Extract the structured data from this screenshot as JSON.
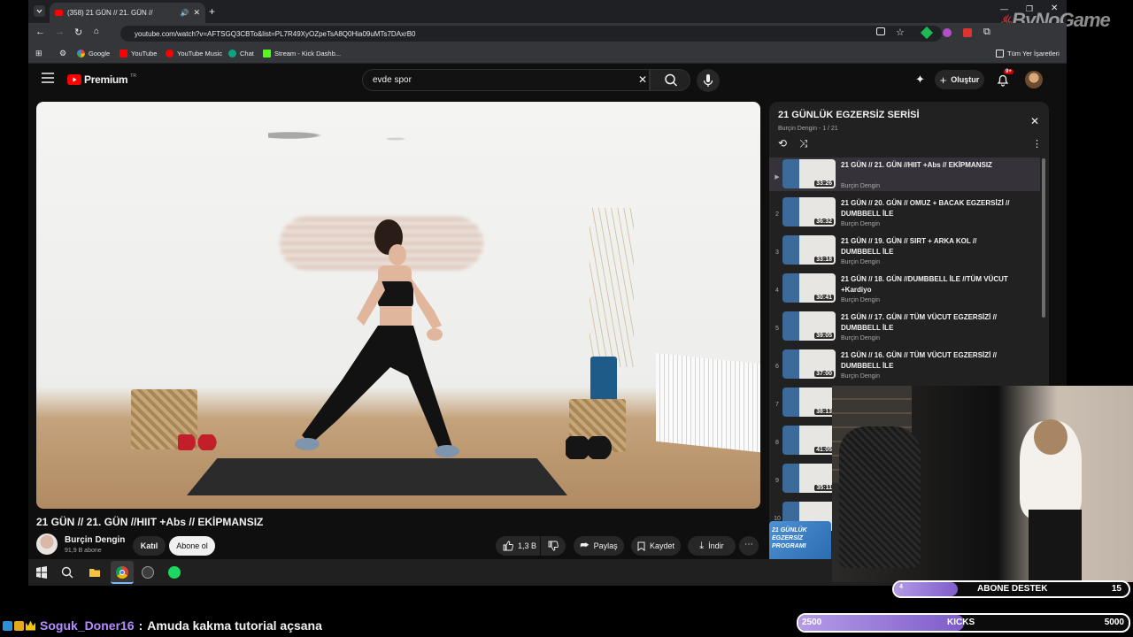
{
  "browser": {
    "tab_title": "(358) 21 GÜN // 21. GÜN //",
    "url": "youtube.com/watch?v=AFTSGQ3CBTo&list=PL7R49XyOZpeTsA8Q0Hia09uMTs7DAxrB0",
    "bookmarks": [
      "Google",
      "YouTube",
      "YouTube Music",
      "Chat",
      "Stream - Kick Dashb..."
    ],
    "all_bookmarks": "Tüm Yer İşaretleri"
  },
  "watermark": "ByNoGame",
  "youtube": {
    "logo_text": "Premium",
    "logo_sup": "TR",
    "search_value": "evde spor",
    "create_label": "Oluştur",
    "notification_badge": "9+",
    "video": {
      "title": "21 GÜN // 21. GÜN //HIIT +Abs // EKİPMANSIZ",
      "channel": "Burçin Dengin",
      "subscribers": "91,9 B abone",
      "join_label": "Katıl",
      "subscribe_label": "Abone ol",
      "likes": "1,3 B",
      "share_label": "Paylaş",
      "save_label": "Kaydet",
      "download_label": "İndir"
    },
    "playlist": {
      "title": "21 GÜNLÜK EGZERSİZ SERİSİ",
      "subtitle": "Burçin Dengin - 1 / 21",
      "items": [
        {
          "index": "▶",
          "title": "21 GÜN // 21. GÜN //HIIT +Abs // EKİPMANSIZ",
          "channel": "Burçin Dengin",
          "duration": "33:26"
        },
        {
          "index": "2",
          "title": "21 GÜN // 20. GÜN // OMUZ + BACAK EGZERSİZİ // DUMBBELL İLE",
          "channel": "Burçin Dengin",
          "duration": "36:32"
        },
        {
          "index": "3",
          "title": "21 GÜN // 19. GÜN // SIRT + ARKA KOL // DUMBBELL İLE",
          "channel": "Burçin Dengin",
          "duration": "33:18"
        },
        {
          "index": "4",
          "title": "21 GÜN // 18. GÜN //DUMBBELL İLE //TÜM VÜCUT +Kardiyo",
          "channel": "Burçin Dengin",
          "duration": "30:41"
        },
        {
          "index": "5",
          "title": "21 GÜN // 17. GÜN // TÜM VÜCUT EGZERSİZİ // DUMBBELL İLE",
          "channel": "Burçin Dengin",
          "duration": "39:05"
        },
        {
          "index": "6",
          "title": "21 GÜN // 16. GÜN // TÜM VÜCUT EGZERSİZİ // DUMBBELL İLE",
          "channel": "Burçin Dengin",
          "duration": "37:00"
        },
        {
          "index": "7",
          "title": "",
          "channel": "",
          "duration": "38:13"
        },
        {
          "index": "8",
          "title": "",
          "channel": "",
          "duration": "41:05"
        },
        {
          "index": "9",
          "title": "",
          "channel": "",
          "duration": "35:11"
        },
        {
          "index": "10",
          "title": "",
          "channel": "",
          "duration": ""
        }
      ]
    },
    "side_card_text": "21 GÜNLÜK EGZERSİZ PROGRAMI"
  },
  "overlay": {
    "sub_goal": {
      "label": "ABONE DESTEK",
      "current": "4",
      "target": "15",
      "progress": 0.27
    },
    "kicks_goal": {
      "label": "KICKS",
      "current": "2500",
      "target": "5000",
      "progress": 0.5
    },
    "chat": {
      "username": "Soguk_Doner16",
      "separator": ":",
      "message": "Amuda kakma tutorial açsana"
    }
  },
  "colors": {
    "yt_red": "#ff0000",
    "goal_purple": "#9b7be0",
    "chat_user": "#b48cff"
  }
}
